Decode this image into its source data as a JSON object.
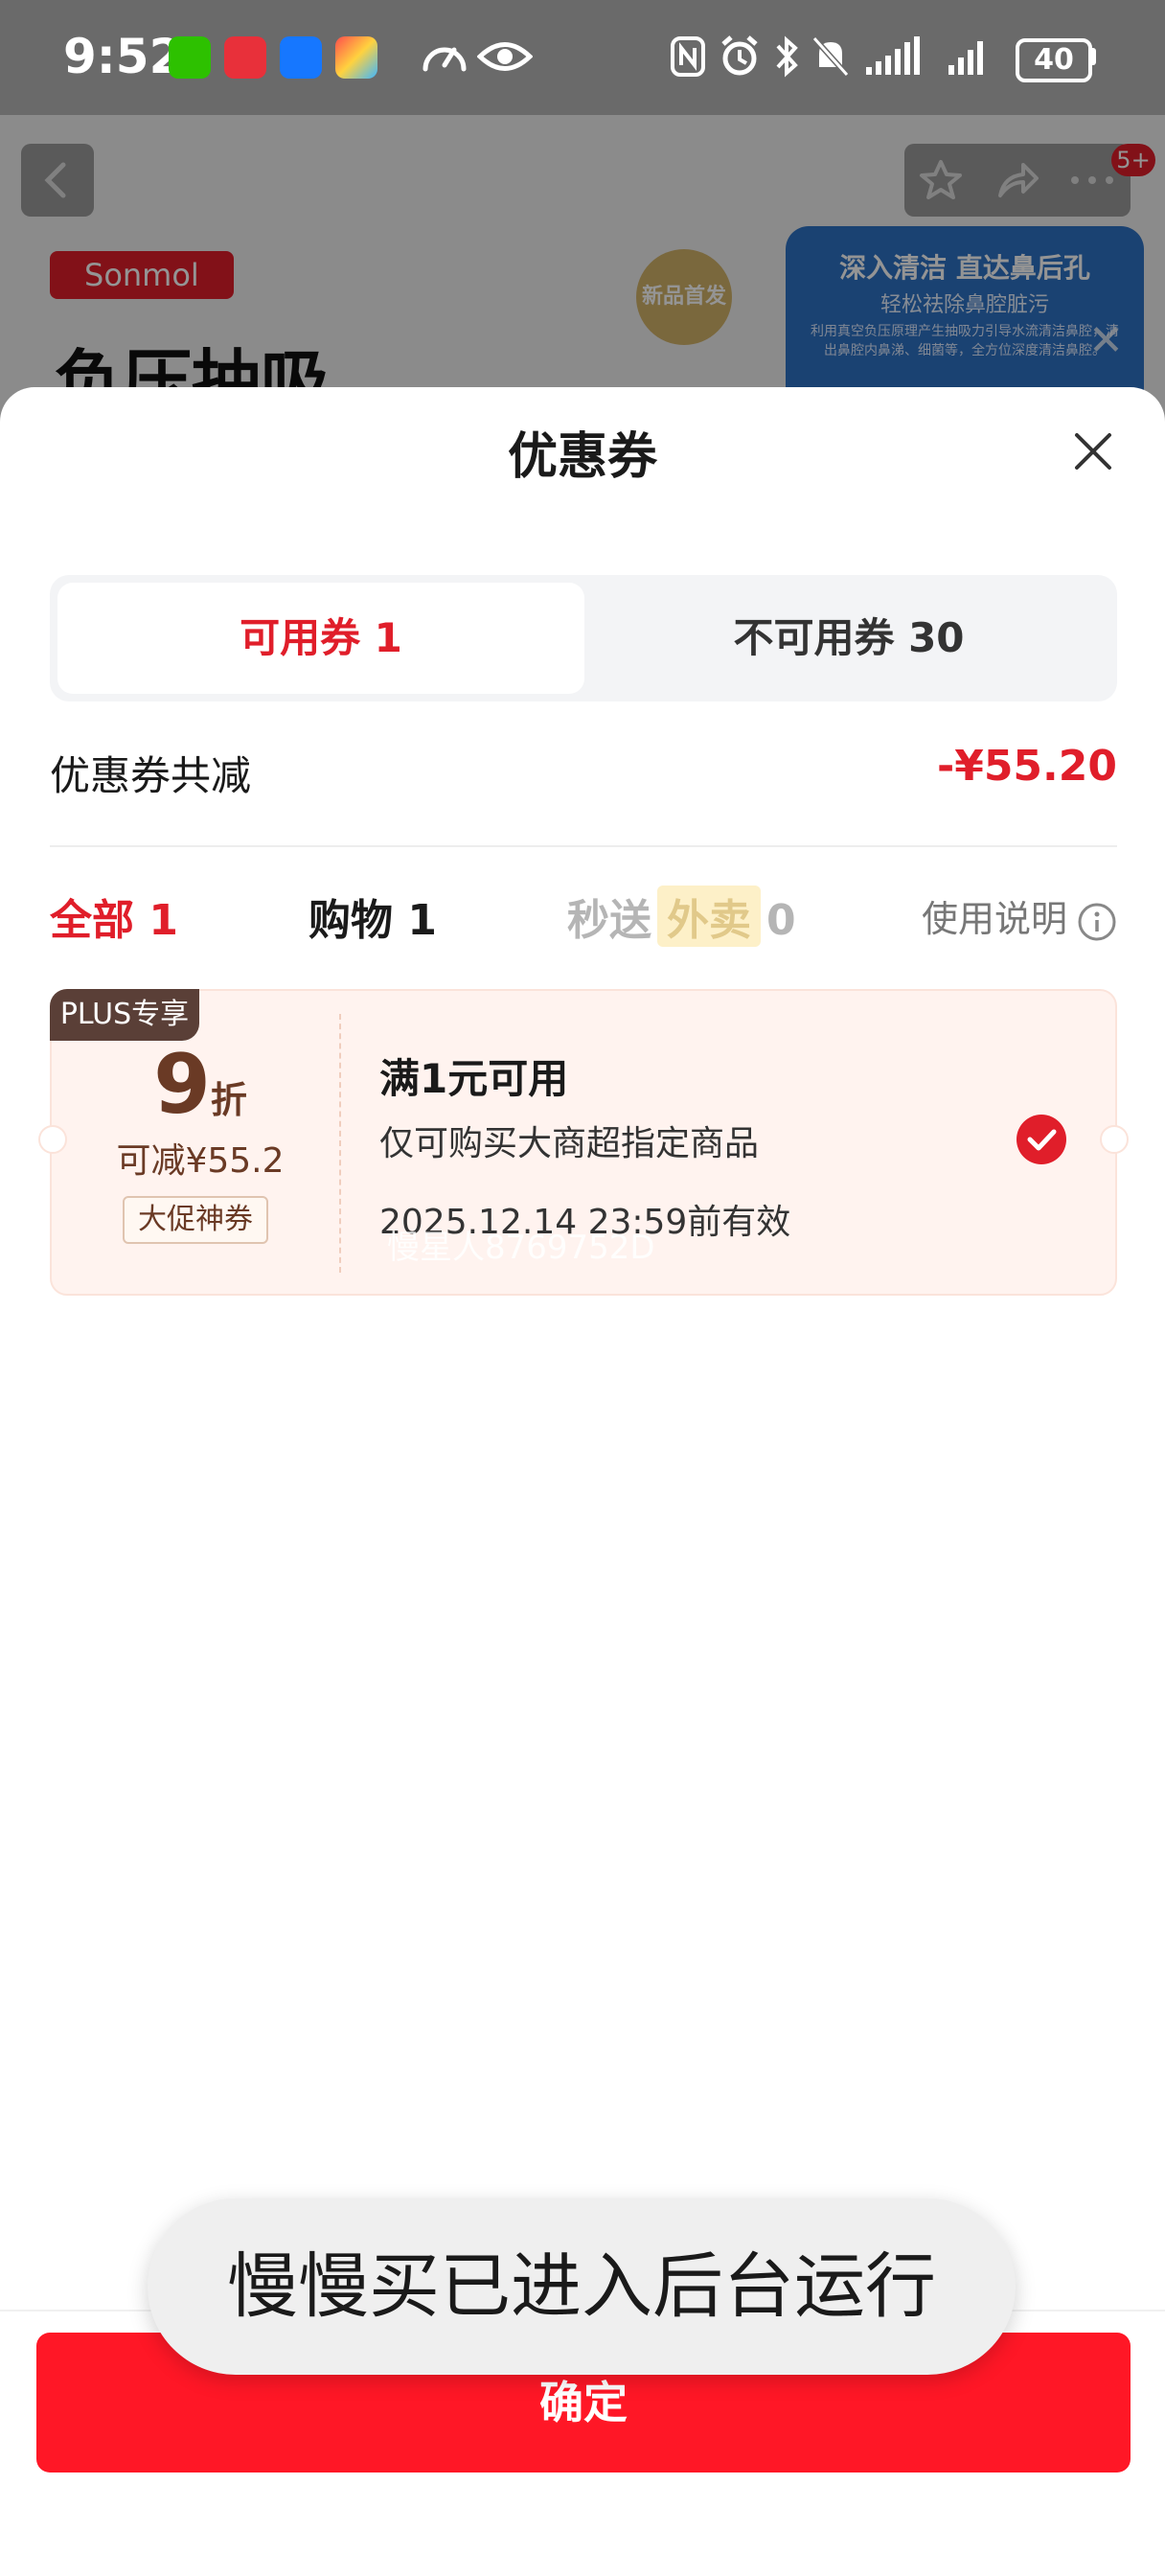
{
  "status_bar": {
    "time": "9:52",
    "battery": "40",
    "app_icons": [
      "wechat-icon",
      "huawei-icon",
      "alipay-icon",
      "colorful-app-icon"
    ],
    "system_icons": [
      "speedometer-icon",
      "eye-icon",
      "nfc-icon",
      "alarm-icon",
      "bluetooth-icon",
      "mute-icon",
      "signal-icon",
      "signal-icon"
    ]
  },
  "background_page": {
    "brand": "Sonmol",
    "hero_text": "负压抽吸",
    "seal_text": "新品首发",
    "badge": "5+",
    "promo": {
      "title": "深入清洁 直达鼻后孔",
      "subtitle": "轻松祛除鼻腔脏污",
      "small": "利用真空负压原理产生抽吸力引导水流清洁鼻腔，清出鼻腔内鼻涕、细菌等，全方位深度清洁鼻腔。"
    }
  },
  "sheet": {
    "title": "优惠券",
    "tabs": [
      {
        "label": "可用券 1",
        "active": true
      },
      {
        "label": "不可用券 30",
        "active": false
      }
    ],
    "summary": {
      "label": "优惠券共减",
      "value": "-¥55.20"
    },
    "filters": {
      "all": "全部 1",
      "shopping": "购物 1",
      "sec_prefix": "秒送",
      "sec_tag": "外卖",
      "sec_count": "0",
      "usage": "使用说明"
    },
    "coupon": {
      "tag": "PLUS专享",
      "discount": "9",
      "discount_unit": "折",
      "reduce": "可减¥55.2",
      "label": "大促神券",
      "condition": "满1元可用",
      "scope": "仅可购买大商超指定商品",
      "expire": "2025.12.14 23:59前有效",
      "watermark": "慢星人8769752D",
      "selected": true
    },
    "confirm": "确定",
    "toast": "慢慢买已进入后台运行"
  },
  "colors": {
    "accent": "#e01e2a",
    "confirm_button": "#ff1726",
    "coupon_bg": "#fff3ef"
  }
}
